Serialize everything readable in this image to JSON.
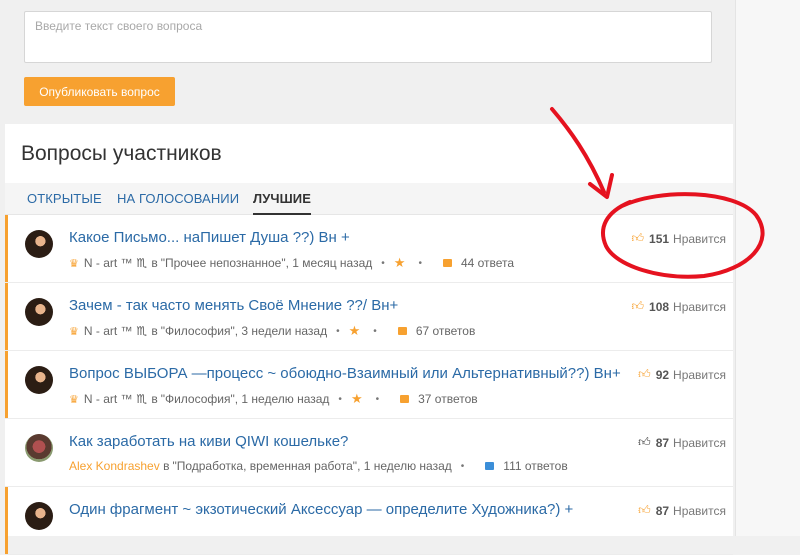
{
  "ask": {
    "placeholder": "Введите текст своего вопроса",
    "value": "",
    "publish_label": "Опубликовать вопрос"
  },
  "section": {
    "title": "Вопросы участников",
    "tabs": [
      {
        "label": "ОТКРЫТЫЕ",
        "active": false
      },
      {
        "label": "НА ГОЛОСОВАНИИ",
        "active": false
      },
      {
        "label": "ЛУЧШИЕ",
        "active": true
      }
    ]
  },
  "likes_label": "Нравится",
  "in_label": "в",
  "questions": [
    {
      "title": "Какое Письмо... наПишет Душа ??) Вн +",
      "author": "N - art ™",
      "zodiac": "♏",
      "category": "\"Прочее непознанное\",",
      "time": "1 месяц назад",
      "answers": "44 ответа",
      "likes": "151"
    },
    {
      "title": "Зачем - так часто менять Своё Мнение ??/ Вн+",
      "author": "N - art ™",
      "zodiac": "♏",
      "category": "\"Философия\",",
      "time": "3 недели назад",
      "answers": "67 ответов",
      "likes": "108"
    },
    {
      "title": "Вопрос ВЫБОРА —процесс ~ обоюдно-Взаимный или Альтернативный??) Вн+",
      "author": "N - art ™",
      "zodiac": "♏",
      "category": "\"Философия\",",
      "time": "1 неделю назад",
      "answers": "37 ответов",
      "likes": "92"
    },
    {
      "title": "Как заработать на киви QIWI кошельке?",
      "author": "Alex Kondrashev",
      "category": "\"Подработка, временная работа\",",
      "time": "1 неделю назад",
      "answers": "111 ответов",
      "likes": "87"
    },
    {
      "title": "Один фрагмент ~ экзотический Аксессуар — определите Художника?) +",
      "likes": "87"
    }
  ],
  "colors": {
    "accent": "#f7a130",
    "link": "#2b6aa6",
    "annotation": "#e5121f"
  }
}
